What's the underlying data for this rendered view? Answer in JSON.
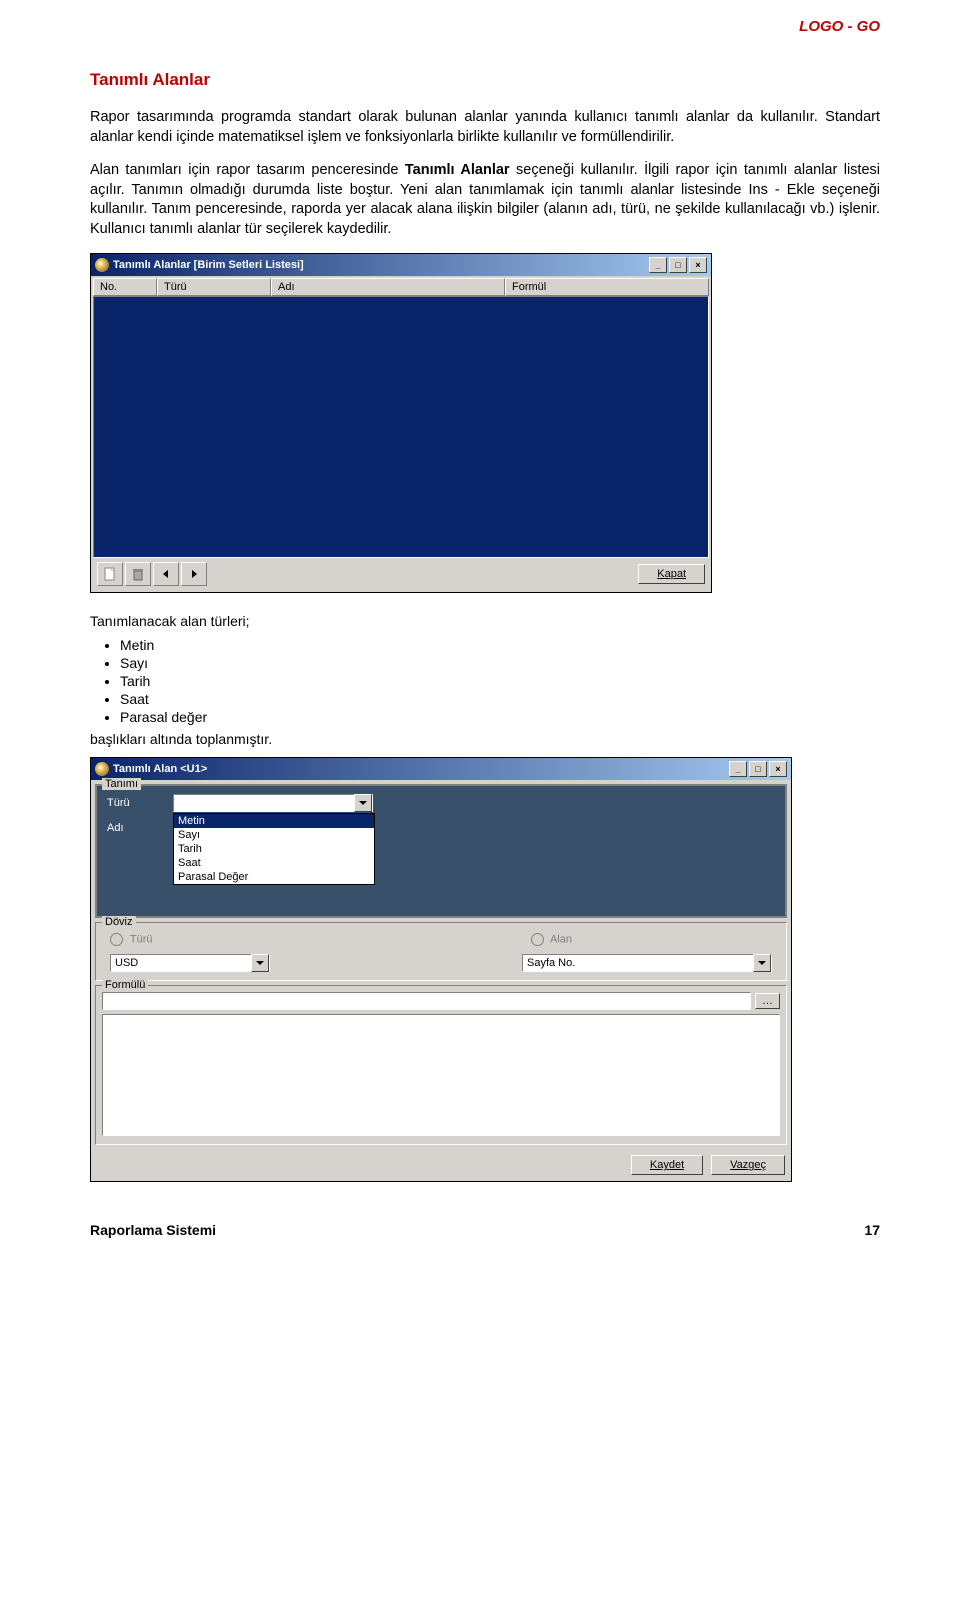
{
  "header_brand": "LOGO - GO",
  "section_title": "Tanımlı Alanlar",
  "para1": "Rapor tasarımında programda standart olarak bulunan alanlar yanında kullanıcı tanımlı alanlar da kullanılır. Standart alanlar kendi içinde matematiksel işlem ve fonksiyonlarla birlikte kullanılır ve formüllendirilir.",
  "para2a": "Alan tanımları için rapor tasarım penceresinde ",
  "para2b": "Tanımlı Alanlar",
  "para2c": " seçeneği kullanılır. İlgili rapor için tanımlı alanlar listesi açılır. Tanımın olmadığı durumda liste boştur. Yeni alan tanımlamak için tanımlı alanlar listesinde Ins - Ekle seçeneği kullanılır. Tanım penceresinde, raporda yer alacak alana ilişkin bilgiler (alanın adı, türü, ne şekilde kullanılacağı vb.) işlenir. Kullanıcı tanımlı alanlar tür seçilerek kaydedilir.",
  "win1": {
    "title": "Tanımlı Alanlar [Birim Setleri Listesi]",
    "cols": {
      "no": "No.",
      "turu": "Türü",
      "adi": "Adı",
      "formul": "Formül"
    },
    "close_label": "Kapat"
  },
  "types_intro": "Tanımlanacak alan türleri;",
  "types": [
    "Metin",
    "Sayı",
    "Tarih",
    "Saat",
    "Parasal değer"
  ],
  "types_after": "başlıkları altında toplanmıştır.",
  "win2": {
    "title": "Tanımlı Alan <U1>",
    "group_tanimi": "Tanımı",
    "lbl_turu": "Türü",
    "lbl_adi": "Adı",
    "combo_value": "Metin",
    "options": [
      "Metin",
      "Sayı",
      "Tarih",
      "Saat",
      "Parasal Değer"
    ],
    "group_doviz": "Döviz",
    "radio_turu": "Türü",
    "radio_alan": "Alan",
    "usd": "USD",
    "sayfa": "Sayfa No.",
    "group_formulu": "Formülü",
    "btn_kaydet": "Kaydet",
    "btn_vazgec": "Vazgeç"
  },
  "footer": {
    "left": "Raporlama Sistemi",
    "right": "17"
  }
}
